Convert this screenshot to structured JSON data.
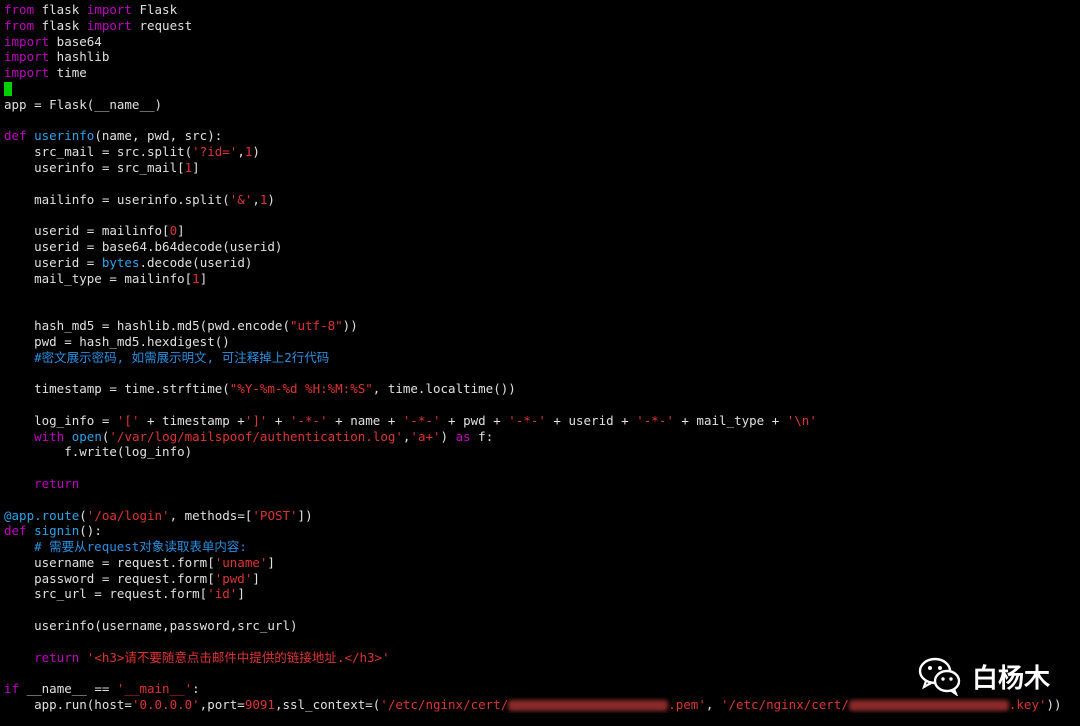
{
  "code": {
    "l1": [
      "from",
      " flask ",
      "import",
      " Flask"
    ],
    "l2": [
      "from",
      " flask ",
      "import",
      " request"
    ],
    "l3": [
      "import",
      " base64"
    ],
    "l4": [
      "import",
      " hashlib"
    ],
    "l5": [
      "import",
      " time"
    ],
    "l7": "app = Flask(__name__)",
    "l9": [
      "def",
      " ",
      "userinfo",
      "(name, pwd, src):"
    ],
    "l10": [
      "    src_mail = src.split(",
      "'?id='",
      ",",
      "1",
      ")"
    ],
    "l11": [
      "    userinfo = src_mail[",
      "1",
      "]"
    ],
    "l13": [
      "    mailinfo = userinfo.split(",
      "'&'",
      ",",
      "1",
      ")"
    ],
    "l15": [
      "    userid = mailinfo[",
      "0",
      "]"
    ],
    "l16": "    userid = base64.b64decode(userid)",
    "l17": [
      "    userid = ",
      "bytes",
      ".decode(userid)"
    ],
    "l18": [
      "    mail_type = mailinfo[",
      "1",
      "]"
    ],
    "l21": [
      "    hash_md5 = hashlib.md5(pwd.encode(",
      "\"utf-8\"",
      "))"
    ],
    "l22": "    pwd = hash_md5.hexdigest()",
    "l23": "    #密文展示密码, 如需展示明文, 可注释掉上2行代码",
    "l25": [
      "    timestamp = time.strftime(",
      "\"%Y-%m-%d %H:%M:%S\"",
      ", time.localtime())"
    ],
    "l27": [
      "    log_info = ",
      "'['",
      " + timestamp +",
      "']'",
      " + ",
      "'-*-'",
      " + name + ",
      "'-*-'",
      " + pwd + ",
      "'-*-'",
      " + userid + ",
      "'-*-'",
      " + mail_type + ",
      "'\\n'"
    ],
    "l28": [
      "    ",
      "with",
      " ",
      "open",
      "(",
      "'/var/log/mailspoof/authentication.log'",
      ",",
      "'a+'",
      ") ",
      "as",
      " f:"
    ],
    "l29": "        f.write(log_info)",
    "l31": [
      "    ",
      "return"
    ],
    "l33": [
      "@app.route",
      "(",
      "'/oa/login'",
      ", methods=[",
      "'POST'",
      "])"
    ],
    "l34": [
      "def",
      " ",
      "signin",
      "():"
    ],
    "l35": "    # 需要从request对象读取表单内容:",
    "l36": [
      "    username = request.form[",
      "'uname'",
      "]"
    ],
    "l37": [
      "    password = request.form[",
      "'pwd'",
      "]"
    ],
    "l38": [
      "    src_url = request.form[",
      "'id'",
      "]"
    ],
    "l40": "    userinfo(username,password,src_url)",
    "l42": [
      "    ",
      "return",
      " ",
      "'<h3>请不要随意点击邮件中提供的链接地址.</h3>'"
    ],
    "l44": [
      "if",
      " __name__ == ",
      "'__main__'",
      ":"
    ],
    "l45": [
      "    app.run(host=",
      "'0.0.0.0'",
      ",port=",
      "9091",
      ",ssl_context=(",
      "'/etc/nginx/cert/",
      ".pem'",
      ", ",
      "'/etc/nginx/cert/",
      ".key'",
      "))"
    ]
  },
  "watermark": {
    "text": "白杨木",
    "icon": "wechat-icon"
  },
  "colors": {
    "background": "#000000",
    "keyword": "#c000c0",
    "string": "#e03232",
    "function": "#2aa4e8",
    "comment": "#2a8fe0",
    "cursor": "#00d000"
  }
}
